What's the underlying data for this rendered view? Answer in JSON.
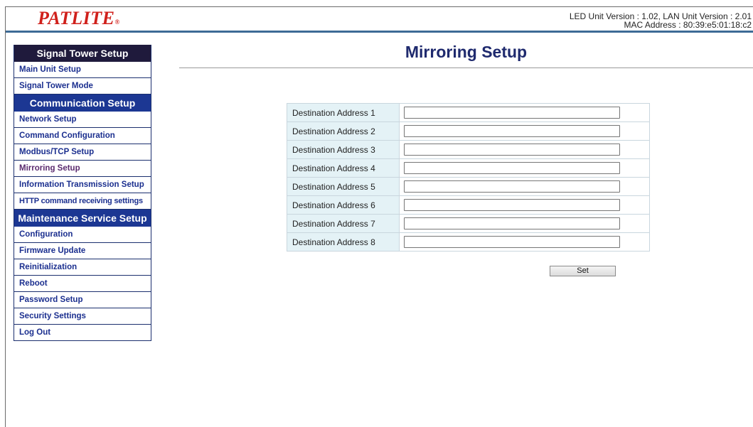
{
  "header": {
    "logo_text": "PATLITE",
    "logo_mark": "®",
    "version_line": "LED Unit Version : 1.02, LAN Unit Version : 2.01",
    "mac_line": "MAC Address : 80:39:e5:01:18:c2"
  },
  "sidebar": {
    "sections": [
      {
        "title": "Signal Tower Setup",
        "items": [
          "Main Unit Setup",
          "Signal Tower Mode"
        ]
      },
      {
        "title": "Communication Setup",
        "items": [
          "Network Setup",
          "Command Configuration",
          "Modbus/TCP Setup",
          "Mirroring Setup",
          "Information Transmission Setup",
          "HTTP command receiving settings"
        ]
      },
      {
        "title": "Maintenance Service Setup",
        "items": [
          "Configuration",
          "Firmware Update",
          "Reinitialization",
          "Reboot",
          "Password Setup",
          "Security Settings",
          "Log Out"
        ]
      }
    ],
    "active_item": "Mirroring Setup"
  },
  "main": {
    "title": "Mirroring Setup",
    "rows": [
      {
        "label": "Destination Address 1",
        "value": ""
      },
      {
        "label": "Destination Address 2",
        "value": ""
      },
      {
        "label": "Destination Address 3",
        "value": ""
      },
      {
        "label": "Destination Address 4",
        "value": ""
      },
      {
        "label": "Destination Address 5",
        "value": ""
      },
      {
        "label": "Destination Address 6",
        "value": ""
      },
      {
        "label": "Destination Address 7",
        "value": ""
      },
      {
        "label": "Destination Address 8",
        "value": ""
      }
    ],
    "set_label": "Set"
  },
  "colors": {
    "logo": "#d0201b",
    "header_line": "#3d6b96",
    "sidebar_section_dark": "#1f1a3c",
    "sidebar_section_blue": "#1c3793",
    "sidebar_link": "#1b2f8f",
    "title": "#1f2a6e",
    "label_cell_bg": "#e4f2f6"
  }
}
